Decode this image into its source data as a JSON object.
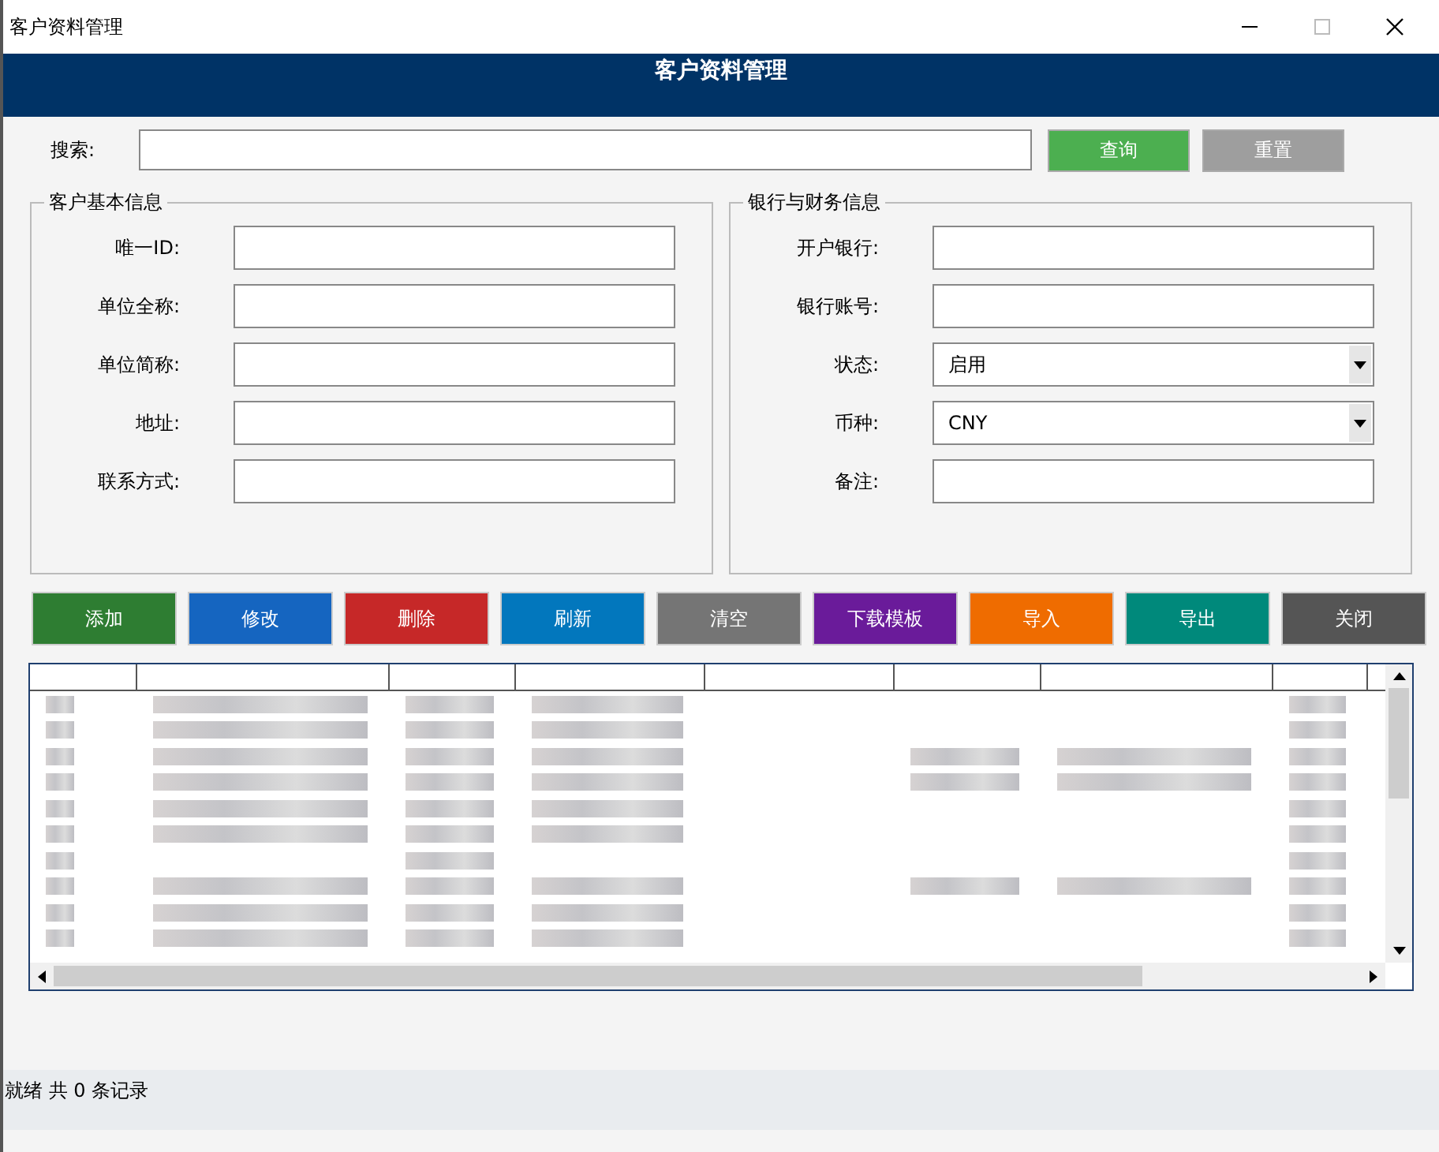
{
  "window": {
    "title": "客户资料管理"
  },
  "header": {
    "title": "客户资料管理"
  },
  "search": {
    "label": "搜索:",
    "buttons": [
      {
        "label": "查询",
        "color": "#4caf50"
      },
      {
        "label": "重置",
        "color": "#9e9e9e"
      }
    ]
  },
  "groups": [
    {
      "title": "客户基本信息",
      "fields": [
        {
          "kind": "text",
          "label": "唯一ID:"
        },
        {
          "kind": "text",
          "label": "单位全称:"
        },
        {
          "kind": "text",
          "label": "单位简称:"
        },
        {
          "kind": "text",
          "label": "地址:"
        },
        {
          "kind": "text",
          "label": "联系方式:"
        }
      ]
    },
    {
      "title": "银行与财务信息",
      "fields": [
        {
          "kind": "text",
          "label": "开户银行:"
        },
        {
          "kind": "text",
          "label": "银行账号:"
        },
        {
          "kind": "select",
          "label": "状态:",
          "value": "启用"
        },
        {
          "kind": "select",
          "label": "币种:",
          "value": "CNY"
        },
        {
          "kind": "text",
          "label": "备注:"
        }
      ]
    }
  ],
  "actions": [
    {
      "label": "添加",
      "color": "#2e7d32"
    },
    {
      "label": "修改",
      "color": "#1565c0"
    },
    {
      "label": "删除",
      "color": "#c62828"
    },
    {
      "label": "刷新",
      "color": "#0277bd"
    },
    {
      "label": "清空",
      "color": "#757575"
    },
    {
      "label": "下载模板",
      "color": "#6a1b9a"
    },
    {
      "label": "导入",
      "color": "#ef6c00"
    },
    {
      "label": "导出",
      "color": "#00897b"
    },
    {
      "label": "关闭",
      "color": "#555555"
    }
  ],
  "status_bar": {
    "text": "就绪  共 0 条记录"
  }
}
